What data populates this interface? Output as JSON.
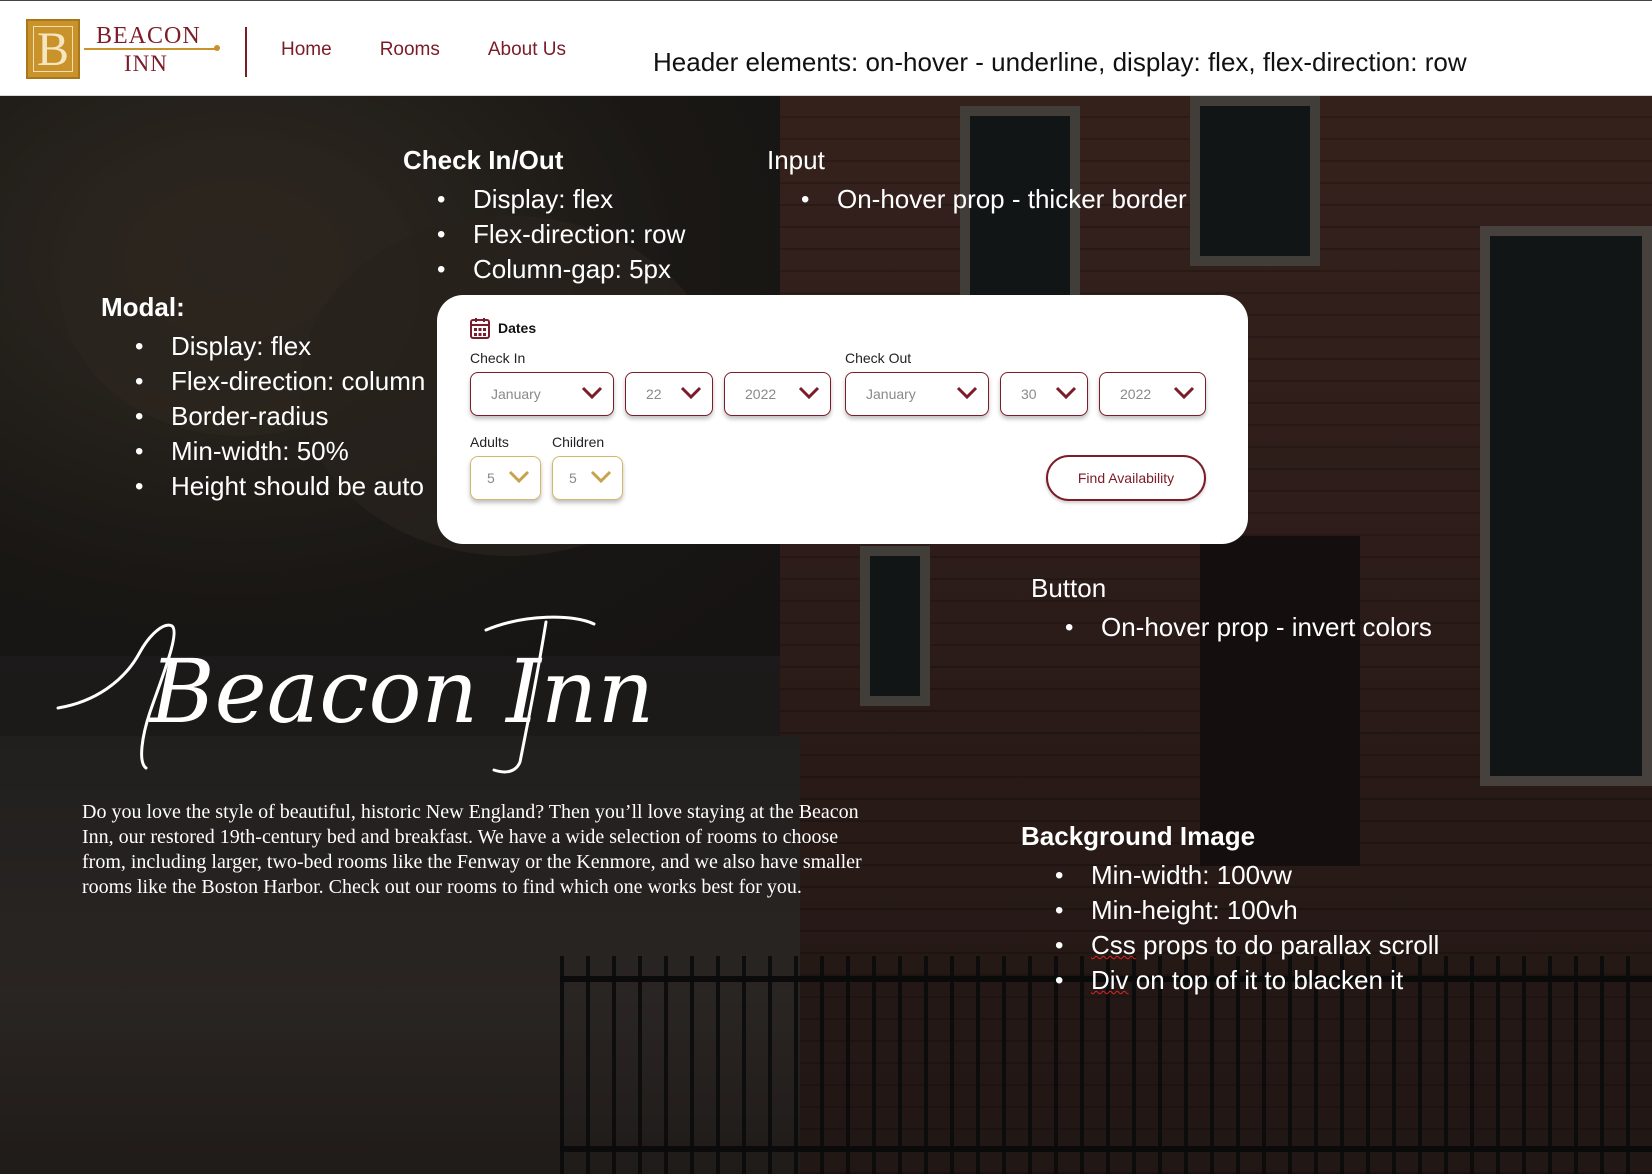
{
  "header": {
    "logo_top": "BEACON",
    "logo_bottom": "INN",
    "logo_letter": "B",
    "nav": [
      {
        "label": "Home"
      },
      {
        "label": "Rooms"
      },
      {
        "label": "About Us"
      }
    ],
    "note": "Header elements: on-hover - underline, display: flex, flex-direction: row"
  },
  "annotations": {
    "checkinout": {
      "title": "Check In/Out",
      "items": [
        "Display: flex",
        "Flex-direction: row",
        "Column-gap: 5px"
      ]
    },
    "input": {
      "title": "Input",
      "items": [
        "On-hover prop - thicker border"
      ]
    },
    "modal": {
      "title": "Modal:",
      "items": [
        "Display: flex",
        "Flex-direction: column",
        "Border-radius",
        "Min-width: 50%",
        "Height should be auto"
      ]
    },
    "button": {
      "title": "Button",
      "items": [
        "On-hover prop - invert colors"
      ]
    },
    "background": {
      "title": "Background Image",
      "items": [
        "Min-width: 100vw",
        "Min-height: 100vh",
        "Css props to do parallax scroll",
        "Div on top of it to blacken it"
      ]
    }
  },
  "booking": {
    "dates_label": "Dates",
    "check_in_label": "Check In",
    "check_out_label": "Check Out",
    "check_in": {
      "month": "January",
      "day": "22",
      "year": "2022"
    },
    "check_out": {
      "month": "January",
      "day": "30",
      "year": "2022"
    },
    "adults_label": "Adults",
    "children_label": "Children",
    "adults": "5",
    "children": "5",
    "find_button": "Find Availability"
  },
  "hero": {
    "title": "Beacon Inn",
    "text": "Do you love the style of beautiful, historic New England? Then you’ll love staying at the Beacon Inn, our restored 19th-century bed and breakfast. We have a wide selection of rooms to choose from, including larger, two-bed rooms like the Fenway or the Kenmore, and we also have smaller rooms like the Boston Harbor. Check out our rooms to find which one works best for you."
  },
  "colors": {
    "brand": "#7b1c28",
    "gold": "#c9922a",
    "input_gold_border": "#d4b86a"
  }
}
